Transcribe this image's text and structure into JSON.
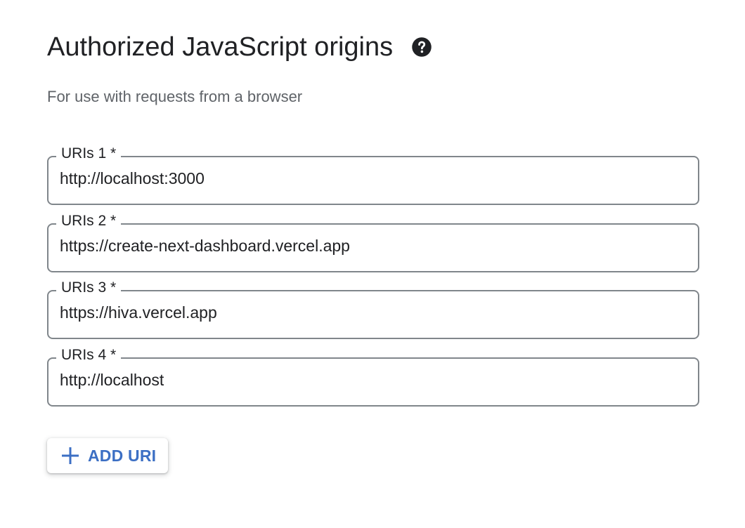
{
  "section": {
    "title": "Authorized JavaScript origins",
    "help_icon": "help-circle-icon",
    "subtitle": "For use with requests from a browser"
  },
  "uris": [
    {
      "label": "URIs 1 *",
      "value": "http://localhost:3000"
    },
    {
      "label": "URIs 2 *",
      "value": "https://create-next-dashboard.vercel.app"
    },
    {
      "label": "URIs 3 *",
      "value": "https://hiva.vercel.app"
    },
    {
      "label": "URIs 4 *",
      "value": "http://localhost"
    }
  ],
  "add_button": {
    "icon": "plus-icon",
    "label": "ADD URI"
  },
  "colors": {
    "accent": "#3c6fc4",
    "text_primary": "#202124",
    "text_secondary": "#5f6368",
    "outline": "#80868b"
  }
}
